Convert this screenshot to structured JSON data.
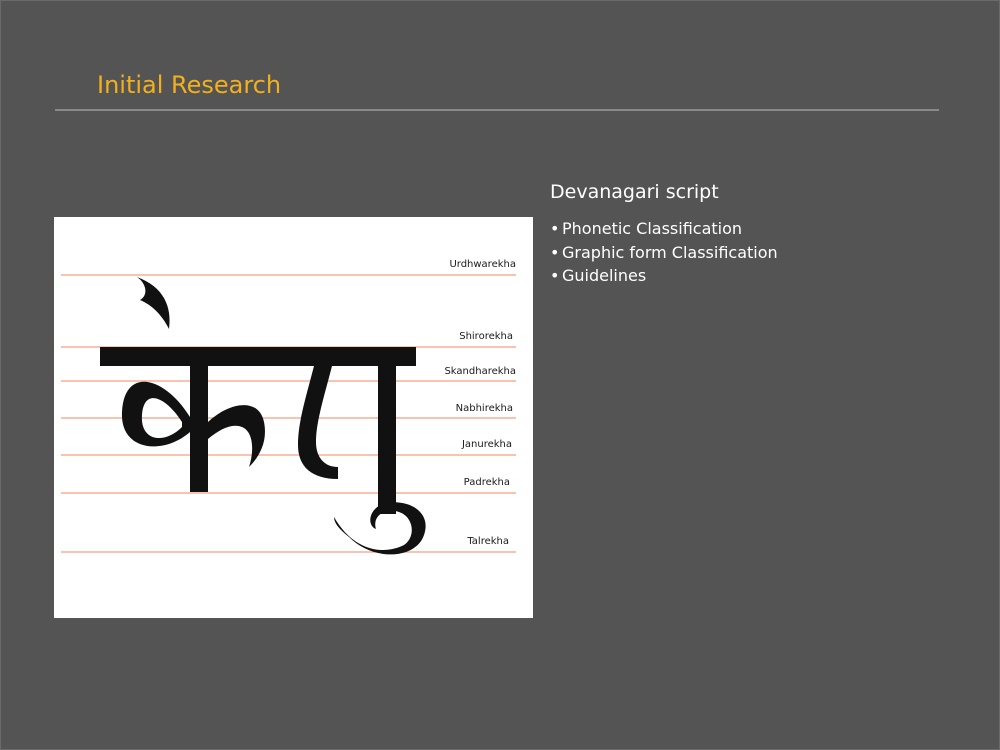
{
  "slide": {
    "title": "Initial Research",
    "title_color": "#f2b01e",
    "background_color": "#545454"
  },
  "figure": {
    "glyph_text": "केतु",
    "guide_color": "#f0a080",
    "guidelines": [
      "Urdhwarekha",
      "Shirorekha",
      "Skandharekha",
      "Nabhirekha",
      "Janurekha",
      "Padrekha",
      "Talrekha"
    ]
  },
  "content": {
    "heading": "Devanagari script",
    "bullets": [
      "Phonetic Classification",
      "Graphic form Classification",
      "Guidelines"
    ],
    "bullet_glyph": "•"
  }
}
